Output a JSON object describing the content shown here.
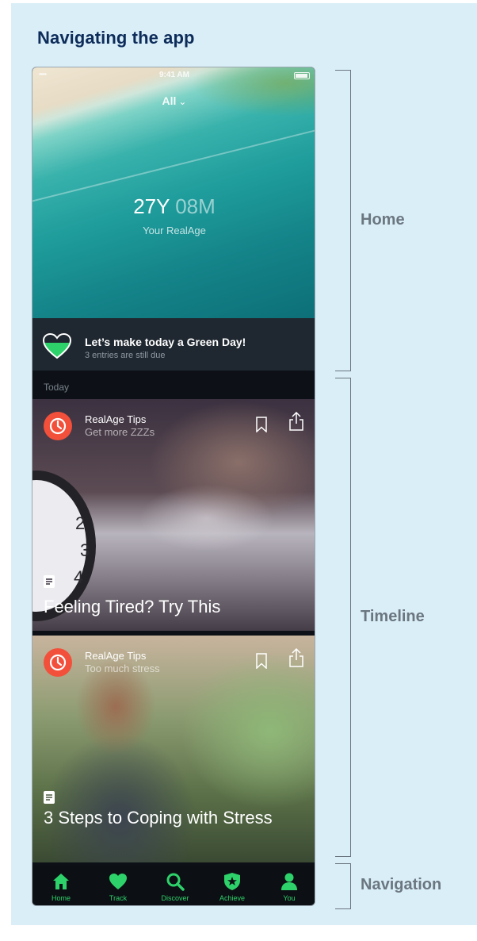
{
  "page": {
    "title": "Navigating the app"
  },
  "status_bar": {
    "carrier": "•••••",
    "time": "9:41 AM"
  },
  "home": {
    "filter_label": "All",
    "real_age_years": "27Y",
    "real_age_months": "08M",
    "real_age_label": "Your RealAge"
  },
  "green_day": {
    "title": "Let’s make today a Green Day!",
    "subtitle": "3 entries are still due"
  },
  "timeline": {
    "section_label": "Today",
    "cards": [
      {
        "source": "RealAge Tips",
        "subtitle": "Get more ZZZs",
        "headline": "Feeling Tired? Try This"
      },
      {
        "source": "RealAge Tips",
        "subtitle": "Too much stress",
        "headline": "3 Steps to Coping with Stress"
      }
    ]
  },
  "tabs": [
    {
      "label": "Home",
      "icon": "home-icon"
    },
    {
      "label": "Track",
      "icon": "heart-icon"
    },
    {
      "label": "Discover",
      "icon": "search-icon"
    },
    {
      "label": "Achieve",
      "icon": "shield-star-icon"
    },
    {
      "label": "You",
      "icon": "person-icon"
    }
  ],
  "annotations": {
    "home": "Home",
    "timeline": "Timeline",
    "navigation": "Navigation"
  },
  "colors": {
    "accent_green": "#2ed26a",
    "title_navy": "#0d2c5a",
    "badge_red": "#f2503b",
    "panel_bg": "#d9eef7"
  }
}
